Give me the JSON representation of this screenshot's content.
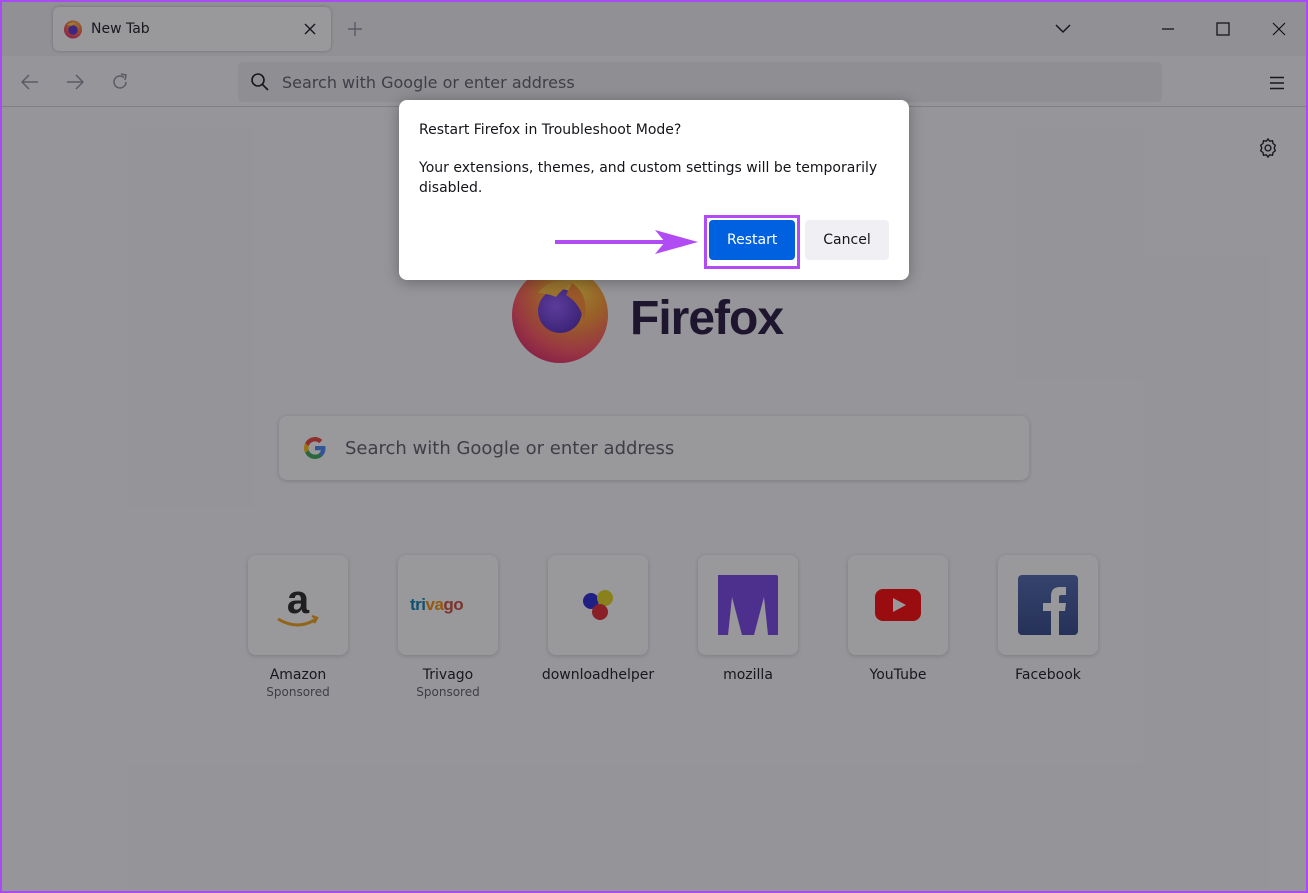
{
  "browser": {
    "tabs": [
      {
        "title": "New Tab",
        "favicon": "firefox-icon",
        "active": true
      }
    ],
    "tab_close_icon": "close-icon",
    "new_tab_icon": "plus-icon",
    "tablist_icon": "chevron-down-icon",
    "window_controls": {
      "minimize": "minimize-icon",
      "maximize": "maximize-icon",
      "close": "close-icon"
    },
    "nav": {
      "back": "back-arrow-icon",
      "forward": "forward-arrow-icon",
      "reload": "reload-icon"
    },
    "urlbar": {
      "placeholder": "Search with Google or enter address",
      "value": ""
    },
    "menu_icon": "hamburger-menu-icon"
  },
  "newtab": {
    "settings_icon": "gear-icon",
    "brand_name": "Firefox",
    "search": {
      "placeholder": "Search with Google or enter address",
      "engine_icon": "google-g-icon"
    },
    "top_sites": [
      {
        "label": "Amazon",
        "sub": "Sponsored",
        "icon": "amazon-icon"
      },
      {
        "label": "Trivago",
        "sub": "Sponsored",
        "icon": "trivago-icon",
        "logo_text": "trivago"
      },
      {
        "label": "downloadhelper",
        "sub": "",
        "icon": "downloadhelper-icon"
      },
      {
        "label": "mozilla",
        "sub": "",
        "icon": "mozilla-icon"
      },
      {
        "label": "YouTube",
        "sub": "",
        "icon": "youtube-icon"
      },
      {
        "label": "Facebook",
        "sub": "",
        "icon": "facebook-icon"
      }
    ]
  },
  "dialog": {
    "title": "Restart Firefox in Troubleshoot Mode?",
    "body": "Your extensions, themes, and custom settings will be temporarily disabled.",
    "primary_button": "Restart",
    "secondary_button": "Cancel"
  },
  "annotation": {
    "color": "#b14cf5",
    "target": "Restart"
  },
  "colors": {
    "accent": "#0061e0",
    "annotation": "#b14cf5",
    "frame": "#a94bf3"
  }
}
